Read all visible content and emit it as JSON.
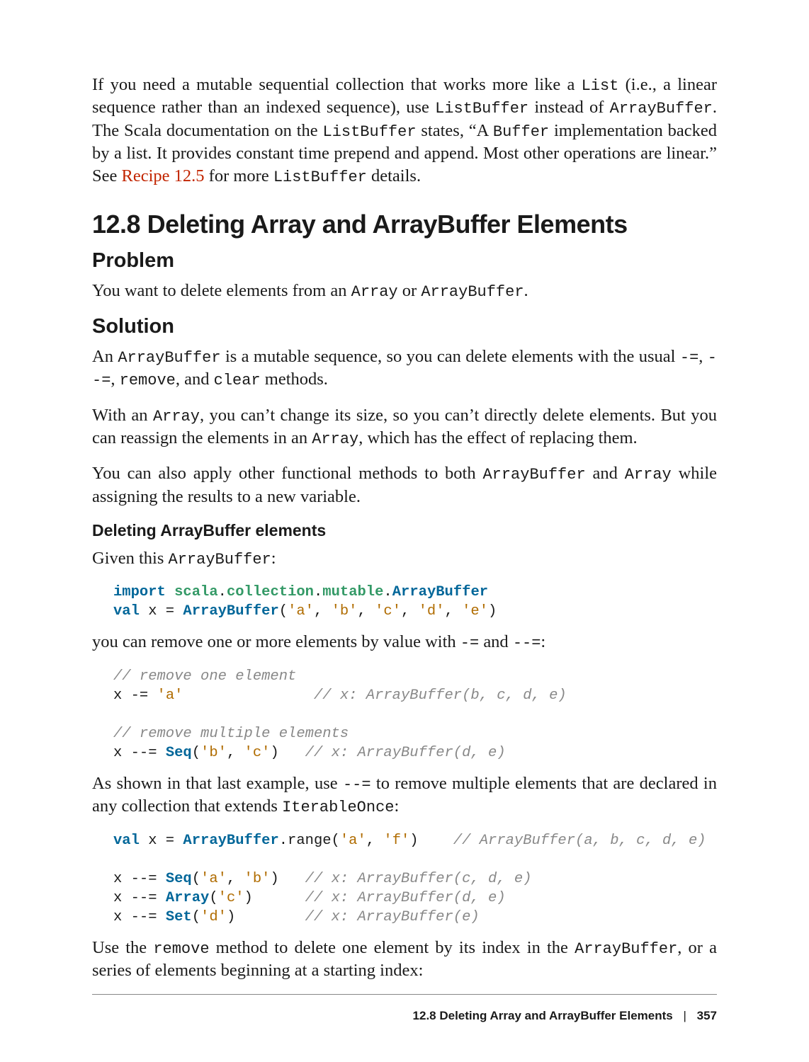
{
  "intro": {
    "pre1": "If you need a mutable sequential collection that works more like a ",
    "code1": "List",
    "mid1": " (i.e., a linear sequence rather than an indexed sequence), use ",
    "code2": "ListBuffer",
    "mid2": " instead of ",
    "code3": "ArrayBuffer",
    "mid3": ". The Scala documentation on the ",
    "code4": "ListBuffer",
    "mid4": " states, “A ",
    "code5": "Buffer",
    "mid5": " implementation backed by a list. It provides constant time prepend and append. Most other opera­tions are linear.” See ",
    "link": "Recipe 12.5",
    "mid6": " for more ",
    "code6": "ListBuffer",
    "tail": " details."
  },
  "section": {
    "title": "12.8 Deleting Array and ArrayBuffer Elements"
  },
  "problem": {
    "heading": "Problem",
    "p_pre": "You want to delete elements from an ",
    "c1": "Array",
    "p_mid": " or ",
    "c2": "ArrayBuffer",
    "p_end": "."
  },
  "solution": {
    "heading": "Solution",
    "p1": {
      "pre": "An ",
      "c1": "ArrayBuffer",
      "mid1": " is a mutable sequence, so you can delete elements with the usual ",
      "c2": "-=",
      "mid2": ", ",
      "c3": "--=",
      "mid3": ", ",
      "c4": "remove",
      "mid4": ", and ",
      "c5": "clear",
      "tail": " methods."
    },
    "p2": {
      "pre": "With an ",
      "c1": "Array",
      "mid1": ", you can’t change its size, so you can’t directly delete elements. But you can reassign the elements in an ",
      "c2": "Array",
      "tail": ", which has the effect of replacing them."
    },
    "p3": {
      "pre": "You can also apply other functional methods to both ",
      "c1": "ArrayBuffer",
      "mid": " and ",
      "c2": "Array",
      "tail": " while assigning the results to a new variable."
    }
  },
  "sub": {
    "heading": "Deleting ArrayBuffer elements",
    "given_pre": "Given this ",
    "given_code": "ArrayBuffer",
    "given_end": ":"
  },
  "code1": {
    "kw_import": "import",
    "mod_scala": "scala",
    "dot1": ".",
    "mod_collection": "collection",
    "dot2": ".",
    "mod_mutable": "mutable",
    "dot3": ".",
    "type_ab": "ArrayBuffer",
    "kw_val": "val",
    "var_x": " x = ",
    "call": "(",
    "s_a": "'a'",
    "c1": ", ",
    "s_b": "'b'",
    "c2": ", ",
    "s_c": "'c'",
    "c3": ", ",
    "s_d": "'d'",
    "c4": ", ",
    "s_e": "'e'",
    "close": ")"
  },
  "para_removeval": {
    "pre": "you can remove one or more elements by value with ",
    "c1": "-=",
    "mid": " and ",
    "c2": "--=",
    "end": ":"
  },
  "code2": {
    "cmt1": "// remove one element",
    "line1_a": "x -= ",
    "line1_s": "'a'",
    "line1_pad": "               ",
    "line1_cmt": "// x: ArrayBuffer(b, c, d, e)",
    "cmt2": "// remove multiple elements",
    "line2_a": "x --= ",
    "seq": "Seq",
    "line2_open": "(",
    "line2_s1": "'b'",
    "line2_c": ", ",
    "line2_s2": "'c'",
    "line2_close": ")   ",
    "line2_cmt": "// x: ArrayBuffer(d, e)"
  },
  "para_iterable": {
    "pre": "As shown in that last example, use ",
    "c1": "--=",
    "mid": " to remove multiple elements that are declared in any collection that extends ",
    "c2": "IterableOnce",
    "end": ":"
  },
  "code3": {
    "kw_val": "val",
    "l1_a": " x = ",
    "ab": "ArrayBuffer",
    "l1_b": ".range(",
    "s_a": "'a'",
    "c1": ", ",
    "s_f": "'f'",
    "l1_c": ")    ",
    "l1_cmt": "// ArrayBuffer(a, b, c, d, e)",
    "l2_a": "x --= ",
    "seq": "Seq",
    "l2_open": "(",
    "l2_s1": "'a'",
    "l2_c": ", ",
    "l2_s2": "'b'",
    "l2_close": ")   ",
    "l2_cmt": "// x: ArrayBuffer(c, d, e)",
    "l3_a": "x --= ",
    "arr": "Array",
    "l3_open": "(",
    "l3_s": "'c'",
    "l3_close": ")      ",
    "l3_cmt": "// x: ArrayBuffer(d, e)",
    "l4_a": "x --= ",
    "set": "Set",
    "l4_open": "(",
    "l4_s": "'d'",
    "l4_close": ")        ",
    "l4_cmt": "// x: ArrayBuffer(e)"
  },
  "para_remove": {
    "pre": "Use the ",
    "c1": "remove",
    "mid1": " method to delete one element by its index in the ",
    "c2": "ArrayBuffer",
    "tail": ", or a series of elements beginning at a starting index:"
  },
  "footer": {
    "title": "12.8 Deleting Array and ArrayBuffer Elements",
    "sep": "|",
    "page": "357"
  }
}
